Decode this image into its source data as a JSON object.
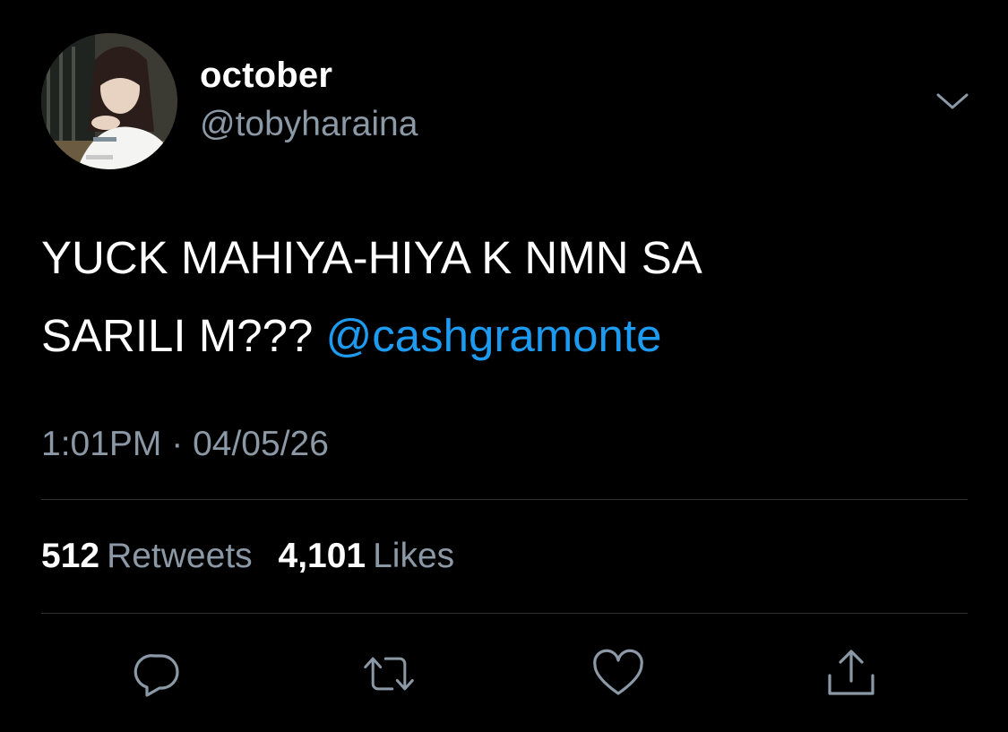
{
  "user": {
    "display_name": "october",
    "handle": "@tobyharaina",
    "avatar_icon": "profile-photo"
  },
  "menu_icon": "chevron-down-icon",
  "tweet": {
    "text_line1": "YUCK MAHIYA-HIYA K NMN SA",
    "text_line2": "SARILI M???",
    "mention": "@cashgramonte",
    "time": "1:01PM",
    "separator": "·",
    "date": "04/05/26"
  },
  "stats": {
    "retweets_count": "512",
    "retweets_label": "Retweets",
    "likes_count": "4,101",
    "likes_label": "Likes"
  },
  "actions": [
    "reply-icon",
    "retweet-icon",
    "like-icon",
    "share-icon"
  ],
  "colors": {
    "background": "#000000",
    "text": "#ffffff",
    "secondary": "#8b98a5",
    "link": "#1d9bf0",
    "divider": "#2f3336"
  }
}
